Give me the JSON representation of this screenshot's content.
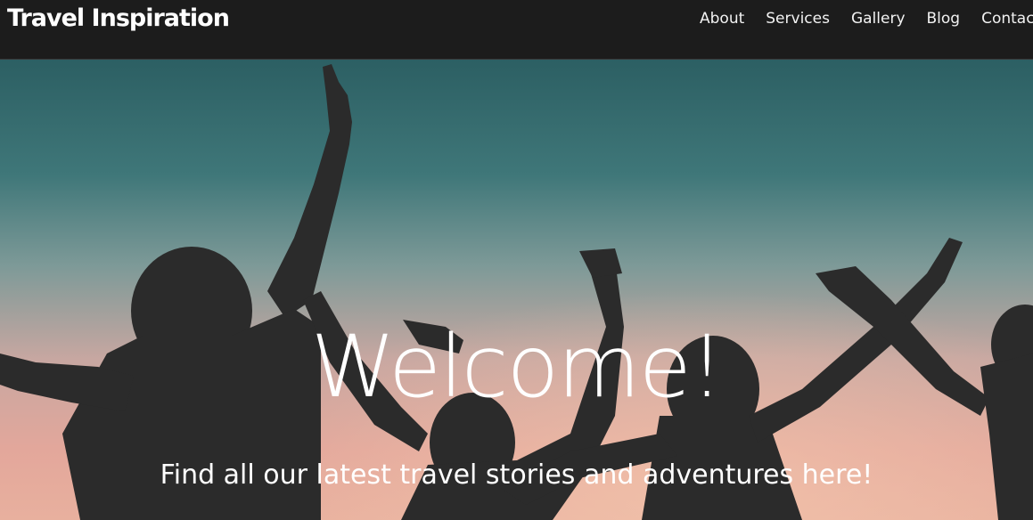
{
  "navbar": {
    "brand": "Travel Inspiration",
    "links": [
      "About",
      "Services",
      "Gallery",
      "Blog",
      "Contact"
    ]
  },
  "hero": {
    "title": "Welcome!",
    "subtitle": "Find all our latest travel stories and adventures here!",
    "image_description_icon": "people-silhouette-sunset-image"
  },
  "colors": {
    "navbar_bg": "#1c1c1c",
    "text": "#ffffff",
    "sky_top": "#2f6266",
    "sky_bottom": "#dfa79b",
    "silhouette": "#2b2b2b"
  }
}
